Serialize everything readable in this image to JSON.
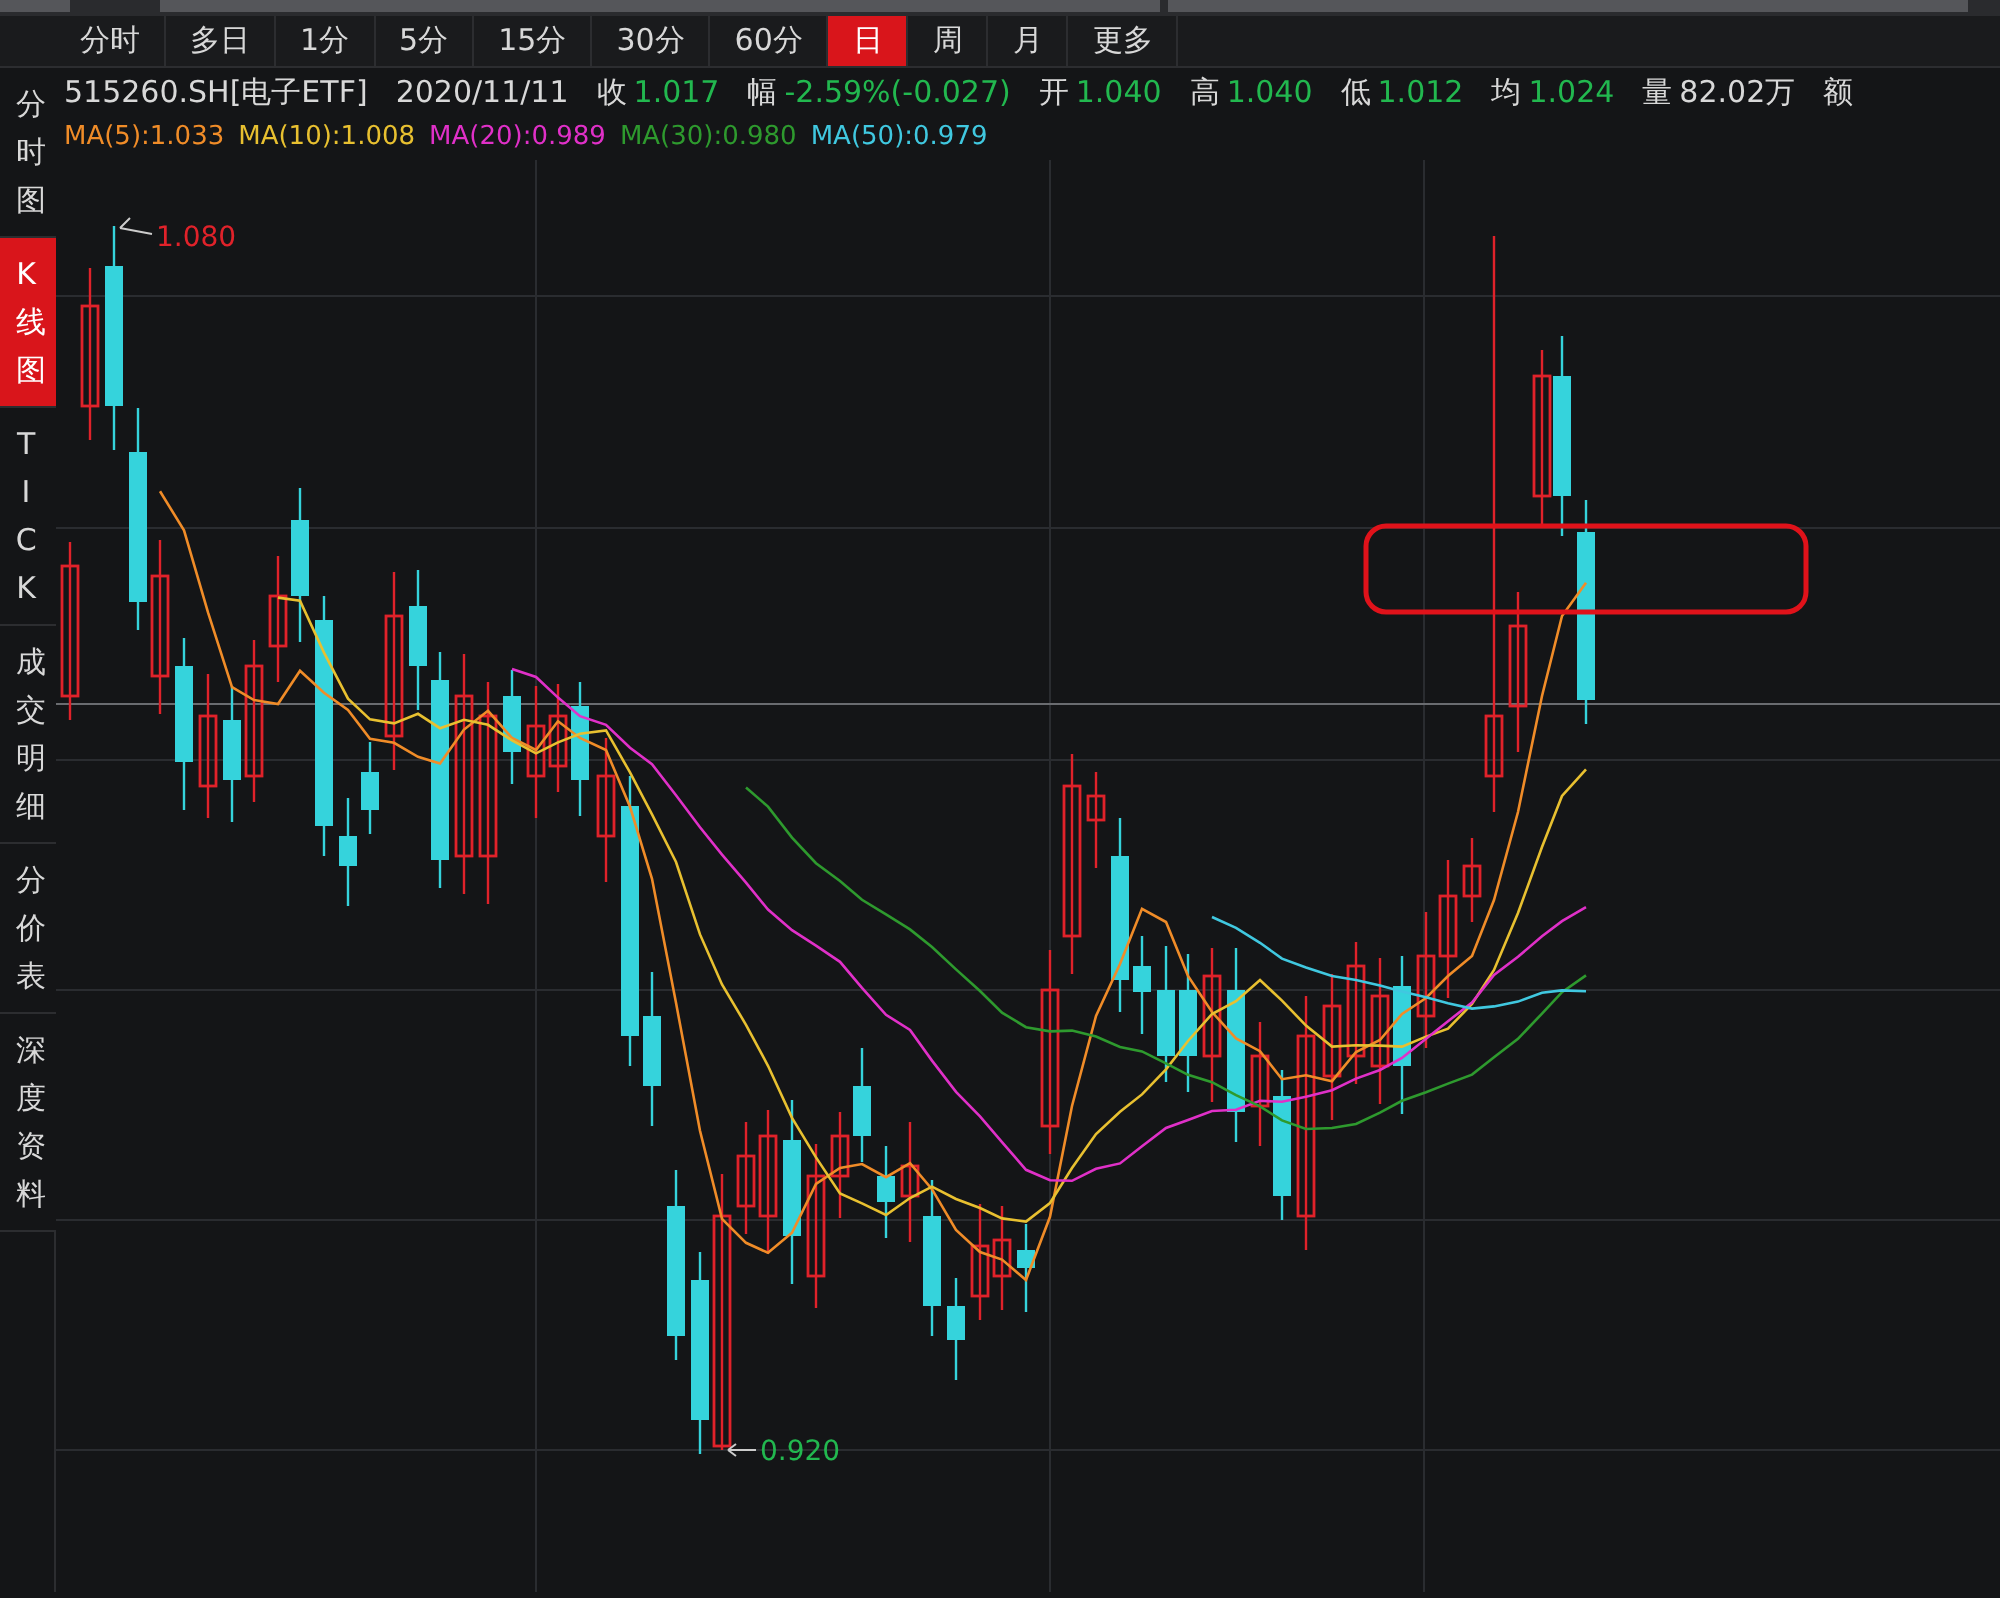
{
  "tabs": [
    {
      "label": "分时",
      "selected": false
    },
    {
      "label": "多日",
      "selected": false
    },
    {
      "label": "1分",
      "selected": false
    },
    {
      "label": "5分",
      "selected": false
    },
    {
      "label": "15分",
      "selected": false
    },
    {
      "label": "30分",
      "selected": false
    },
    {
      "label": "60分",
      "selected": false
    },
    {
      "label": "日",
      "selected": true
    },
    {
      "label": "周",
      "selected": false
    },
    {
      "label": "月",
      "selected": false
    },
    {
      "label": "更多",
      "selected": false
    }
  ],
  "sidebar": [
    {
      "label": "分时图",
      "selected": false
    },
    {
      "label": "K线图",
      "selected": true
    },
    {
      "label": "TICK",
      "selected": false
    },
    {
      "label": "成交明细",
      "selected": false
    },
    {
      "label": "分价表",
      "selected": false
    },
    {
      "label": "深度资料",
      "selected": false
    }
  ],
  "quote": {
    "symbol": "515260.SH[电子ETF]",
    "date": "2020/11/11",
    "fields": [
      {
        "label": "收",
        "value": "1.017",
        "color": "#22b84f"
      },
      {
        "label": "幅",
        "value": "-2.59%(-0.027)",
        "color": "#22b84f"
      },
      {
        "label": "开",
        "value": "1.040",
        "color": "#22b84f"
      },
      {
        "label": "高",
        "value": "1.040",
        "color": "#22b84f"
      },
      {
        "label": "低",
        "value": "1.012",
        "color": "#22b84f"
      },
      {
        "label": "均",
        "value": "1.024",
        "color": "#22b84f"
      },
      {
        "label": "量",
        "value": "82.02万",
        "color": "#d8d8d8"
      },
      {
        "label": "额"
      }
    ]
  },
  "moving_averages": [
    {
      "label": "MA(5):1.033",
      "color": "#f08c28"
    },
    {
      "label": "MA(10):1.008",
      "color": "#e8c030"
    },
    {
      "label": "MA(20):0.989",
      "color": "#e030c8"
    },
    {
      "label": "MA(30):0.980",
      "color": "#2e9a2e"
    },
    {
      "label": "MA(50):0.979",
      "color": "#40c8e0"
    }
  ],
  "chart": {
    "high_label": "1.080",
    "low_label": "0.920"
  }
}
